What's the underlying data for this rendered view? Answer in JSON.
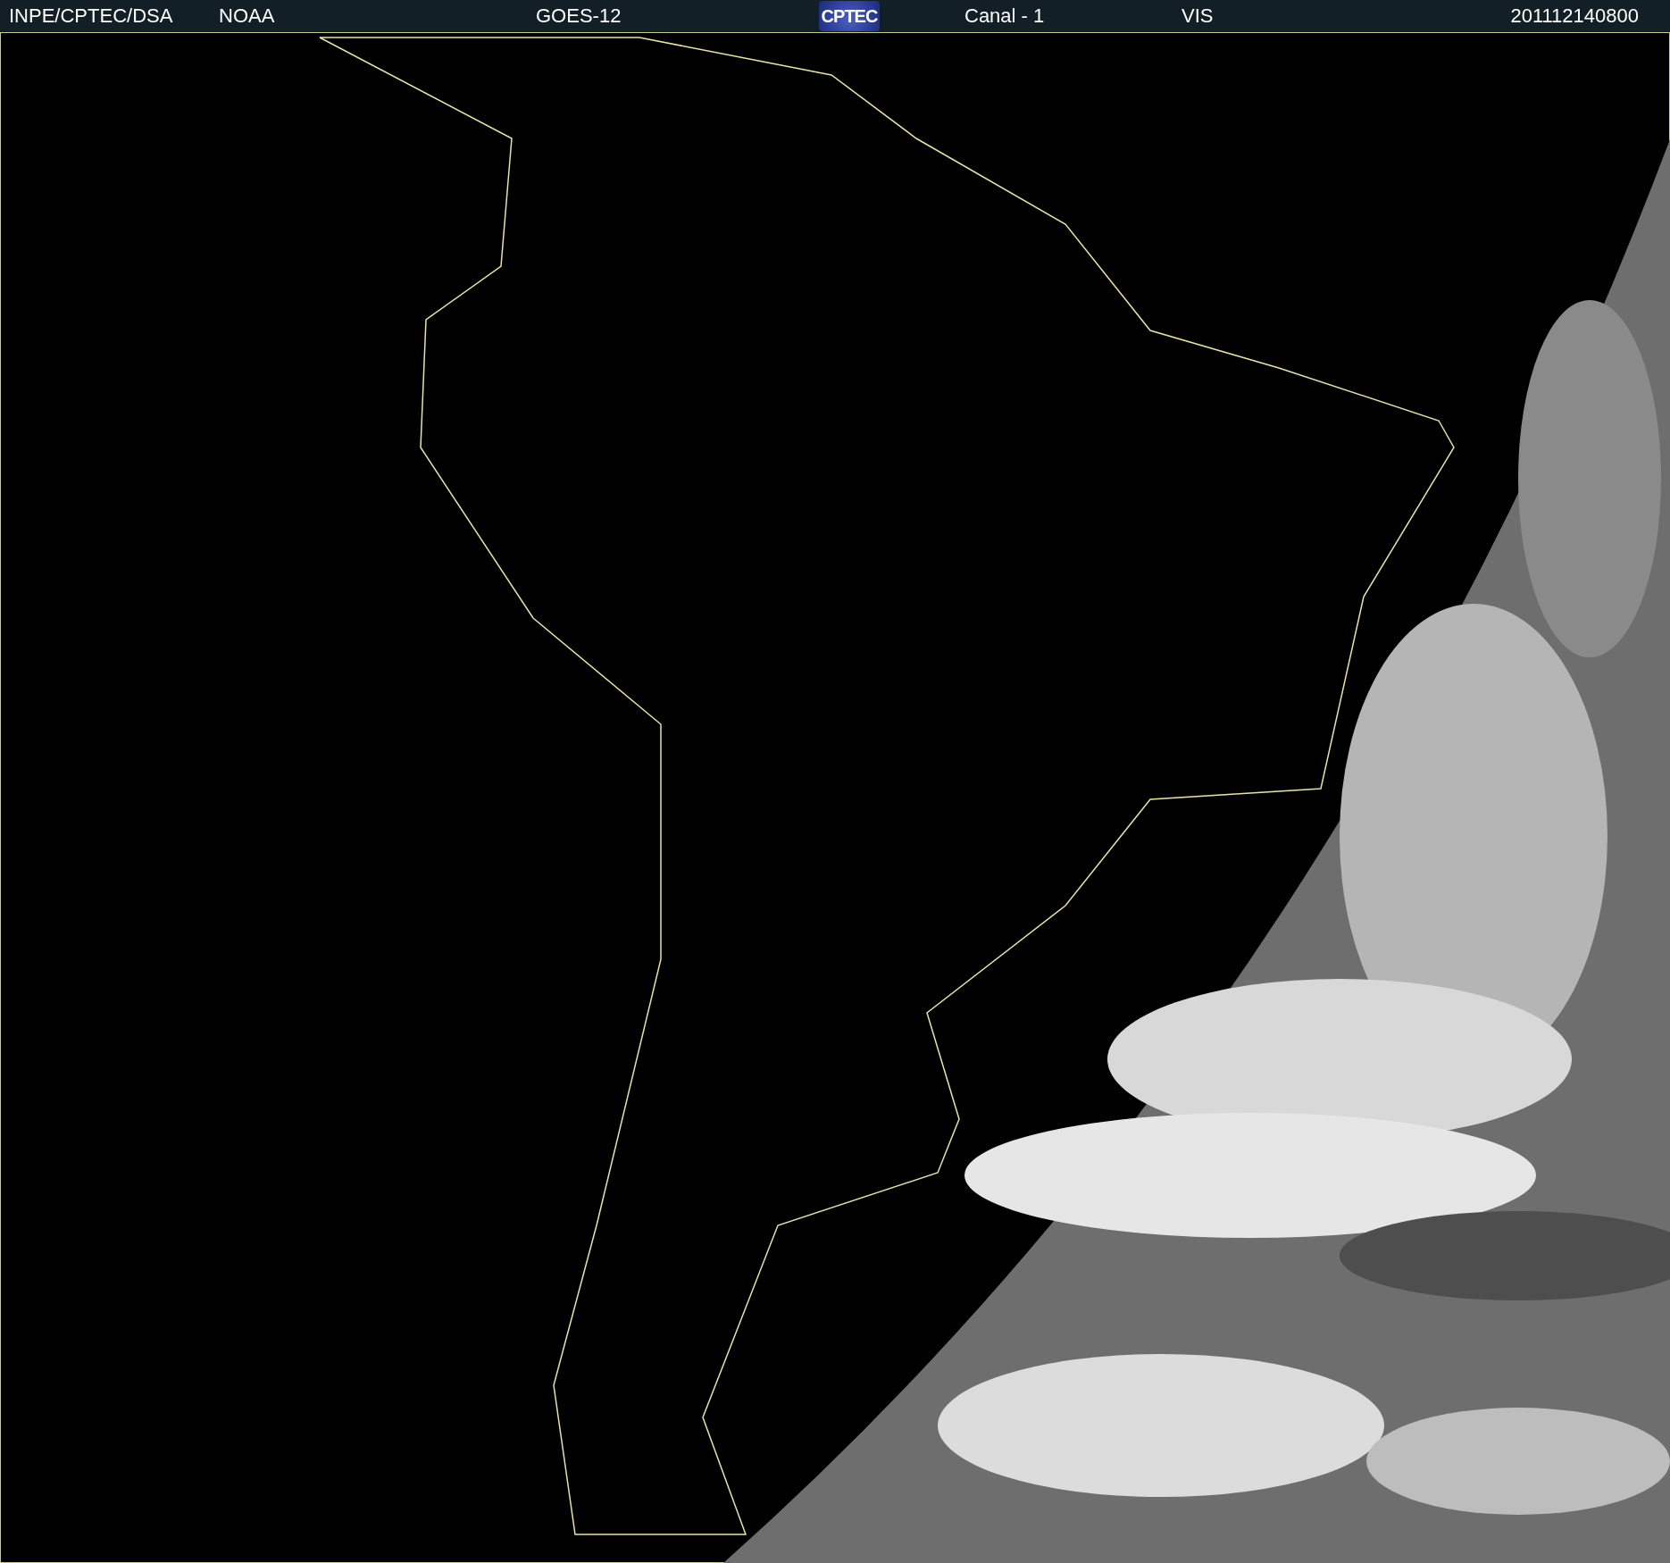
{
  "header": {
    "source": "INPE/CPTEC/DSA",
    "agency": "NOAA",
    "satellite": "GOES-12",
    "logo_text": "CPTEC",
    "channel": "Canal - 1",
    "band": "VIS",
    "timestamp": "201112140800"
  }
}
